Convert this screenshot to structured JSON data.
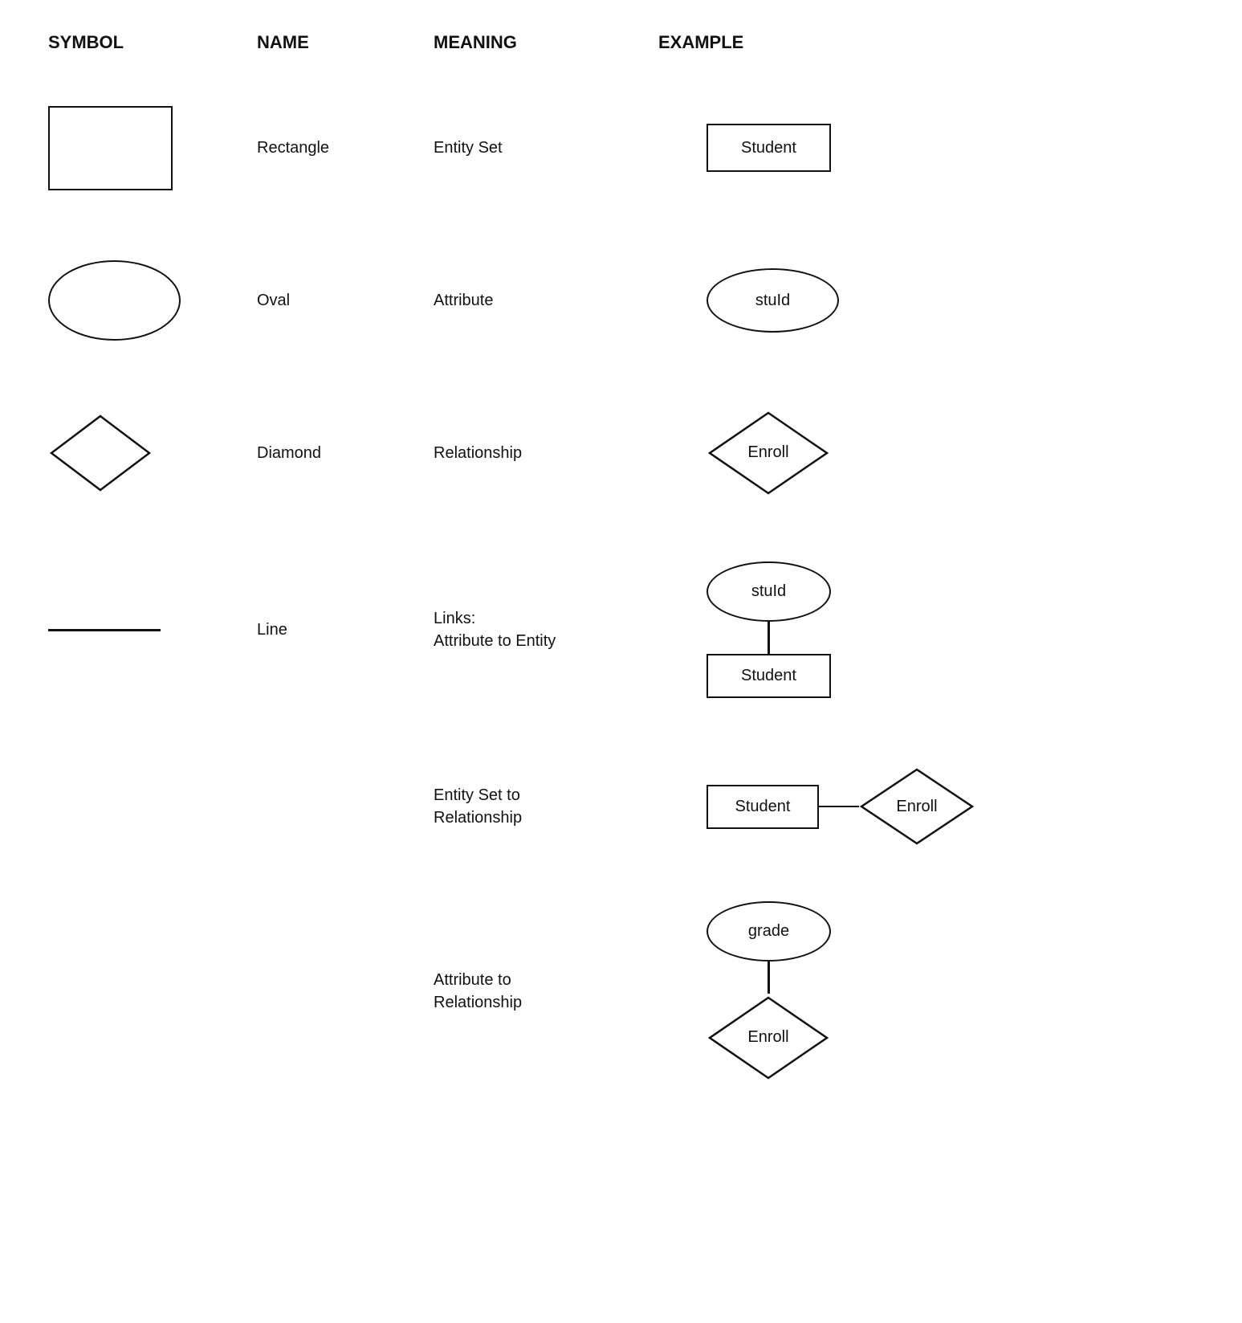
{
  "header": {
    "symbol": "SYMBOL",
    "name": "NAME",
    "meaning": "MEANING",
    "example": "EXAMPLE"
  },
  "rows": [
    {
      "id": "rectangle",
      "symbol_type": "rectangle",
      "name": "Rectangle",
      "meaning": "Entity Set",
      "example_type": "rectangle",
      "example_label": "Student"
    },
    {
      "id": "oval",
      "symbol_type": "oval",
      "name": "Oval",
      "meaning": "Attribute",
      "example_type": "oval",
      "example_label": "stuId"
    },
    {
      "id": "diamond",
      "symbol_type": "diamond",
      "name": "Diamond",
      "meaning": "Relationship",
      "example_type": "diamond",
      "example_label": "Enroll"
    },
    {
      "id": "line",
      "symbol_type": "line",
      "name": "Line",
      "meaning_line1": "Links:",
      "meaning_line2": "Attribute to Entity",
      "example_type": "links",
      "example_oval_label": "stuId",
      "example_rect_label": "Student"
    }
  ],
  "extra_rows": [
    {
      "id": "entity-set-rel",
      "meaning_line1": "Entity Set to",
      "meaning_line2": "Relationship",
      "example_type": "entity-rel",
      "example_rect_label": "Student",
      "example_diamond_label": "Enroll"
    },
    {
      "id": "attr-rel",
      "meaning_line1": "Attribute to",
      "meaning_line2": "Relationship",
      "example_type": "attr-rel",
      "example_oval_label": "grade",
      "example_diamond_label": "Enroll"
    }
  ]
}
